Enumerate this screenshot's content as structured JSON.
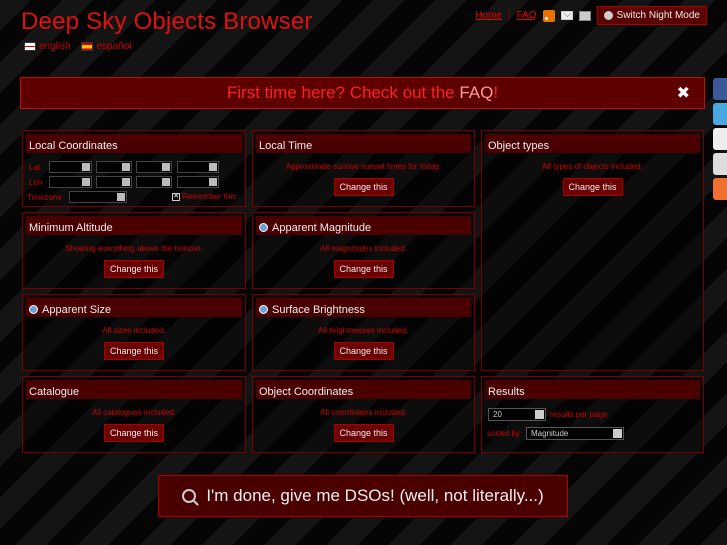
{
  "header": {
    "title": "Deep Sky Objects Browser"
  },
  "languages": [
    {
      "label": "english"
    },
    {
      "label": "español"
    }
  ],
  "toplinks": {
    "home": "Home",
    "faq": "FAQ",
    "night_mode": "Switch Night Mode"
  },
  "banner": {
    "text": "First time here? Check out the",
    "faq_link": "FAQ",
    "suffix": "!",
    "close": "✖"
  },
  "panels": {
    "local_coordinates": {
      "title": "Local Coordinates",
      "lat_label": "Lat",
      "lon_label": "Lon",
      "timezone_label": "Timezone",
      "remember_label": "Remember this"
    },
    "local_time": {
      "title": "Local Time",
      "description": "Approximate sunrise sunset times for today.",
      "button": "Change this"
    },
    "object_types": {
      "title": "Object types",
      "description": "All types of objects included.",
      "button": "Change this"
    },
    "minimum_altitude": {
      "title": "Minimum Altitude",
      "description": "Showing everything above the horizon.",
      "button": "Change this"
    },
    "apparent_magnitude": {
      "title": "Apparent Magnitude",
      "description": "All magnitudes included.",
      "button": "Change this"
    },
    "apparent_size": {
      "title": "Apparent Size",
      "description": "All sizes included.",
      "button": "Change this"
    },
    "surface_brightness": {
      "title": "Surface Brightness",
      "description": "All brightnesses included.",
      "button": "Change this"
    },
    "catalogue": {
      "title": "Catalogue",
      "description": "All catalogues included.",
      "button": "Change this"
    },
    "object_coordinates": {
      "title": "Object Coordinates",
      "description": "All coordinates included.",
      "button": "Change this"
    },
    "results": {
      "title": "Results",
      "per_page_value": "20",
      "per_page_label": "results per page",
      "sorted_by_label": "sorted by",
      "sort_value": "Magnitude"
    }
  },
  "submit": {
    "label": "I'm done, give me DSOs! (well, not literally...)"
  },
  "colors": {
    "accent": "#e01010",
    "panel_header": "#4a0000",
    "button": "#6a0000"
  }
}
